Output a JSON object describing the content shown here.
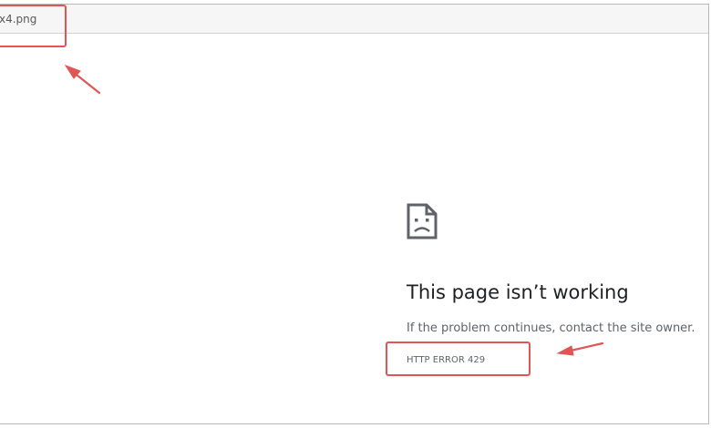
{
  "tab": {
    "url_fragment": "x4.png"
  },
  "error_page": {
    "icon": "sad-page-icon",
    "title": "This page isn’t working",
    "message": "If the problem continues, contact the site owner.",
    "code": "HTTP ERROR 429"
  },
  "annotations": {
    "color": "#e05555",
    "highlights": [
      "url-fragment",
      "error-code"
    ]
  }
}
